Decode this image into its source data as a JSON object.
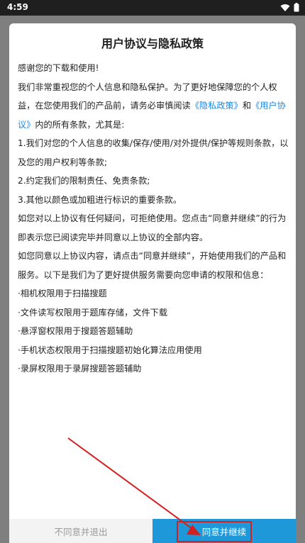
{
  "status_bar": {
    "time": "4:59"
  },
  "dialog": {
    "title": "用户协议与隐私政策",
    "greeting": "感谢您的下载和使用!",
    "intro_1": "我们非常重视您的个人信息和隐私保护。为了更好地保障您的个人权益，在您使用我们的产品前，请务必审慎阅读",
    "link_privacy": "《隐私政策》",
    "intro_and": "和",
    "link_agreement": "《用户协议》",
    "intro_2": "内的所有条款，尤其是:",
    "clause_1": " 1.我们对您的个人信息的收集/保存/使用/对外提供/保护等规则条款，以及您的用户权利等条款;",
    "clause_2": " 2.约定我们的限制责任、免责条款;",
    "clause_3": " 3.其他以颜色或加粗进行标识的重要条款。",
    "refuse_note": " 如您对以上协议有任何疑问，可拒绝使用。您点击“同意并继续”的行为即表示您已阅读完毕并同意以上协议的全部内容。",
    "agree_note": " 如您同意以上协议内容，请点击“同意并继续”，开始使用我们的产品和服务。以下是我们为了更好提供服务需要向您申请的权限和信息：",
    "permissions": [
      "·相机权限用于扫描搜题",
      "·文件读写权限用于题库存储，文件下载",
      "·悬浮窗权限用于搜题答题辅助",
      "·手机状态权限用于扫描搜题初始化算法应用使用",
      "·录屏权限用于录屏搜题答题辅助"
    ]
  },
  "buttons": {
    "decline_label": "不同意并退出",
    "accept_label": "同意并继续"
  },
  "colors": {
    "accent": "#1e98d8",
    "link": "#1e88e5",
    "annotation": "#d42020"
  },
  "icons": [
    "wifi-icon",
    "battery-icon"
  ]
}
